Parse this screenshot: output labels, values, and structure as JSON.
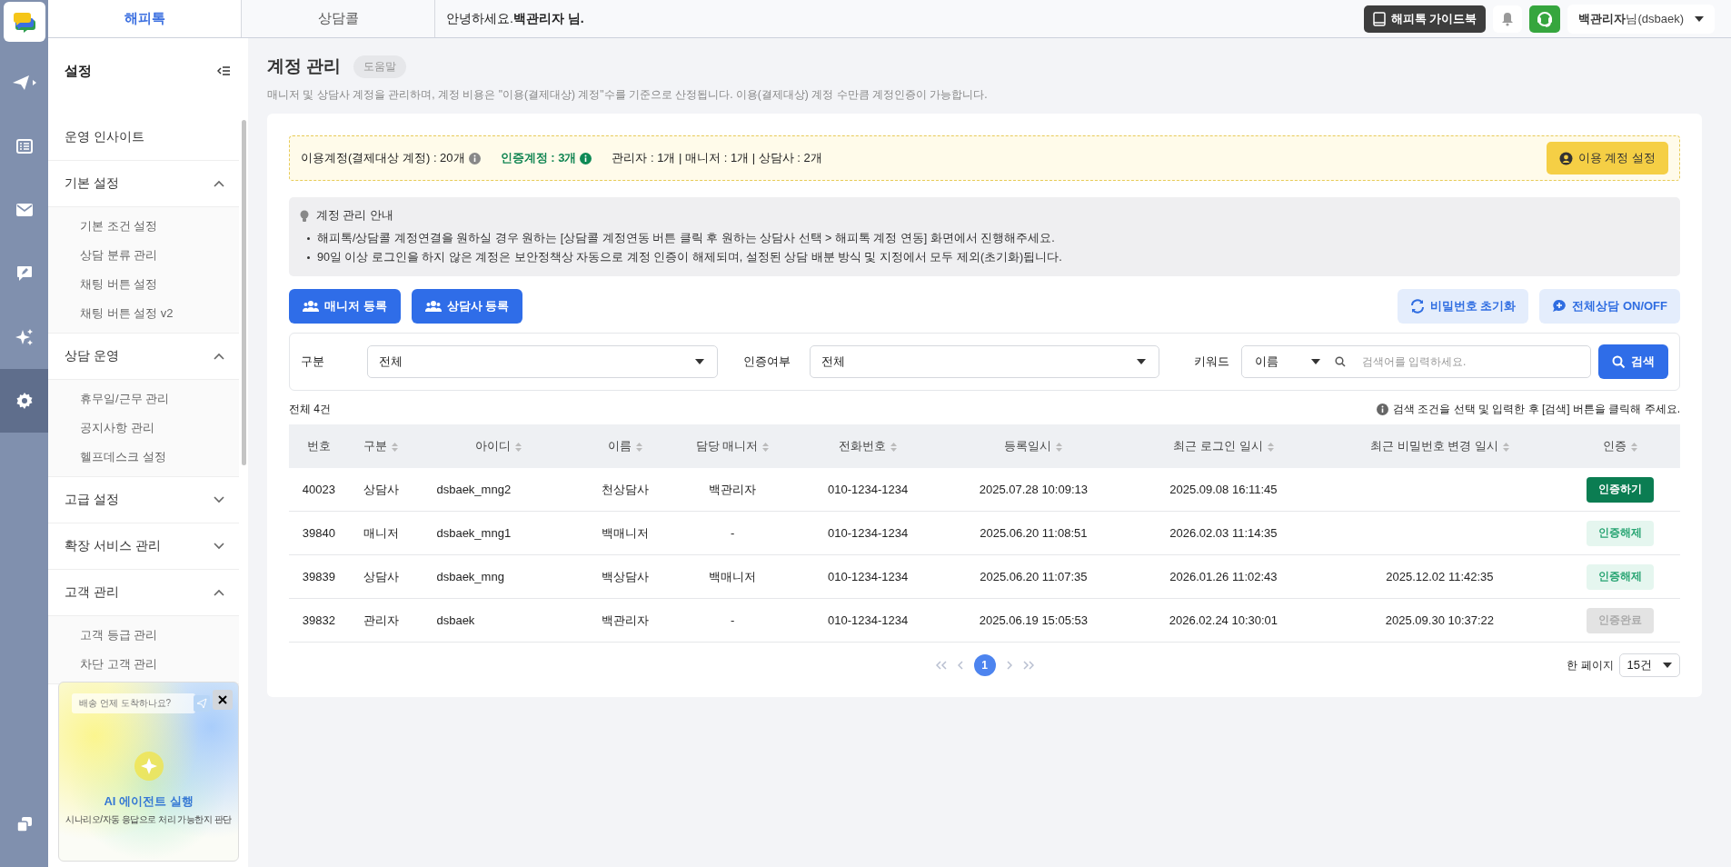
{
  "rail": {
    "items": [
      {
        "selected": false
      },
      {
        "selected": false
      },
      {
        "selected": false
      },
      {
        "selected": false
      },
      {
        "selected": false
      },
      {
        "selected": true
      }
    ]
  },
  "topbar": {
    "tabs": [
      {
        "label": "해피톡",
        "selected": true
      },
      {
        "label": "상담콜",
        "selected": false
      }
    ],
    "greeting": "안녕하세요.",
    "greeting_name": "백관리자 님.",
    "guide_button": "해피톡 가이드북",
    "user_name": "백관리자",
    "user_suffix": "님(dsbaek)"
  },
  "sidebar": {
    "title": "설정",
    "items": [
      {
        "label": "운영 인사이트",
        "kind": "link"
      },
      {
        "label": "기본 설정",
        "kind": "group",
        "expanded": true,
        "children": [
          {
            "label": "기본 조건 설정"
          },
          {
            "label": "상담 분류 관리"
          },
          {
            "label": "채팅 버튼 설정"
          },
          {
            "label": "채팅 버튼 설정 v2"
          }
        ]
      },
      {
        "label": "상담 운영",
        "kind": "group",
        "expanded": true,
        "children": [
          {
            "label": "휴무일/근무 관리"
          },
          {
            "label": "공지사항 관리"
          },
          {
            "label": "헬프데스크 설정"
          }
        ]
      },
      {
        "label": "고급 설정",
        "kind": "group",
        "expanded": false
      },
      {
        "label": "확장 서비스 관리",
        "kind": "group",
        "expanded": false
      },
      {
        "label": "고객 관리",
        "kind": "group",
        "expanded": true,
        "children": [
          {
            "label": "고객 등급 관리"
          },
          {
            "label": "차단 고객 관리"
          }
        ]
      }
    ],
    "promo": {
      "input_placeholder": "배송 언제 도착하나요?",
      "title": "AI 에이전트 실행",
      "subtitle": "시나리오/자동 응답으로 처리 가능한지 판단"
    }
  },
  "page": {
    "title": "계정 관리",
    "help_badge": "도움말",
    "description": "매니저 및 상담사 계정을 관리하며, 계정 비용은 \"이용(결제대상) 계정\"수를 기준으로 산정됩니다. 이용(결제대상) 계정 수만큼 계정인증이 가능합니다."
  },
  "summary": {
    "billing_accounts": "이용계정(결제대상 계정) : 20개",
    "certified_accounts": "인증계정 : 3개",
    "breakdown": "관리자 : 1개 | 매니저 : 1개 | 상담사 : 2개",
    "settings_button": "이용 계정 설정"
  },
  "guide": {
    "title": "계정 관리 안내",
    "lines": [
      "해피톡/상담콜 계정연결을 원하실 경우 원하는 [상담콜 계정연동 버튼 클릭 후 원하는 상담사 선택 > 해피톡 계정 연동] 화면에서 진행해주세요.",
      "90일 이상 로그인을 하지 않은 계정은 보안정책상 자동으로 계정 인증이 해제되며, 설정된 상담 배분 방식 및 지정에서 모두 제외(초기화)됩니다."
    ]
  },
  "actions": {
    "register_manager": "매니저 등록",
    "register_agent": "상담사 등록",
    "reset_password": "비밀번호 초기화",
    "all_consult_toggle": "전체상담 ON/OFF"
  },
  "filters": {
    "type_label": "구분",
    "type_value": "전체",
    "auth_label": "인증여부",
    "auth_value": "전체",
    "keyword_label": "키워드",
    "keyword_field": "이름",
    "keyword_placeholder": "검색어를 입력하세요.",
    "search_button": "검색"
  },
  "results": {
    "total": "전체 4건",
    "hint": "검색 조건을 선택 및 입력한 후 [검색] 버튼을 클릭해 주세요."
  },
  "table": {
    "columns": [
      {
        "label": "번호",
        "sortable": false
      },
      {
        "label": "구분",
        "sortable": true
      },
      {
        "label": "아이디",
        "sortable": true
      },
      {
        "label": "이름",
        "sortable": true
      },
      {
        "label": "담당 매니저",
        "sortable": true
      },
      {
        "label": "전화번호",
        "sortable": true
      },
      {
        "label": "등록일시",
        "sortable": true
      },
      {
        "label": "최근 로그인 일시",
        "sortable": true
      },
      {
        "label": "최근 비밀번호 변경 일시",
        "sortable": true
      },
      {
        "label": "인증",
        "sortable": true
      }
    ],
    "rows": [
      {
        "cells": [
          "40023",
          "상담사",
          "dsbaek_mng2",
          "천상담사",
          "백관리자",
          "010-1234-1234",
          "2025.07.28 10:09:13",
          "2025.09.08 16:11:45",
          ""
        ],
        "auth": {
          "label": "인증하기",
          "kind": "certify"
        }
      },
      {
        "cells": [
          "39840",
          "매니저",
          "dsbaek_mng1",
          "백매니저",
          "-",
          "010-1234-1234",
          "2025.06.20 11:08:51",
          "2026.02.03 11:14:35",
          ""
        ],
        "auth": {
          "label": "인증해제",
          "kind": "revoke"
        }
      },
      {
        "cells": [
          "39839",
          "상담사",
          "dsbaek_mng",
          "백상담사",
          "백매니저",
          "010-1234-1234",
          "2025.06.20 11:07:35",
          "2026.01.26 11:02:43",
          "2025.12.02 11:42:35"
        ],
        "auth": {
          "label": "인증해제",
          "kind": "revoke"
        }
      },
      {
        "cells": [
          "39832",
          "관리자",
          "dsbaek",
          "백관리자",
          "-",
          "010-1234-1234",
          "2025.06.19 15:05:53",
          "2026.02.24 10:30:01",
          "2025.09.30 10:37:22"
        ],
        "auth": {
          "label": "인증완료",
          "kind": "done"
        }
      }
    ]
  },
  "pagination": {
    "pages": [
      {
        "label": "1",
        "selected": true
      }
    ],
    "page_size_label": "한 페이지",
    "page_size": "15건"
  }
}
